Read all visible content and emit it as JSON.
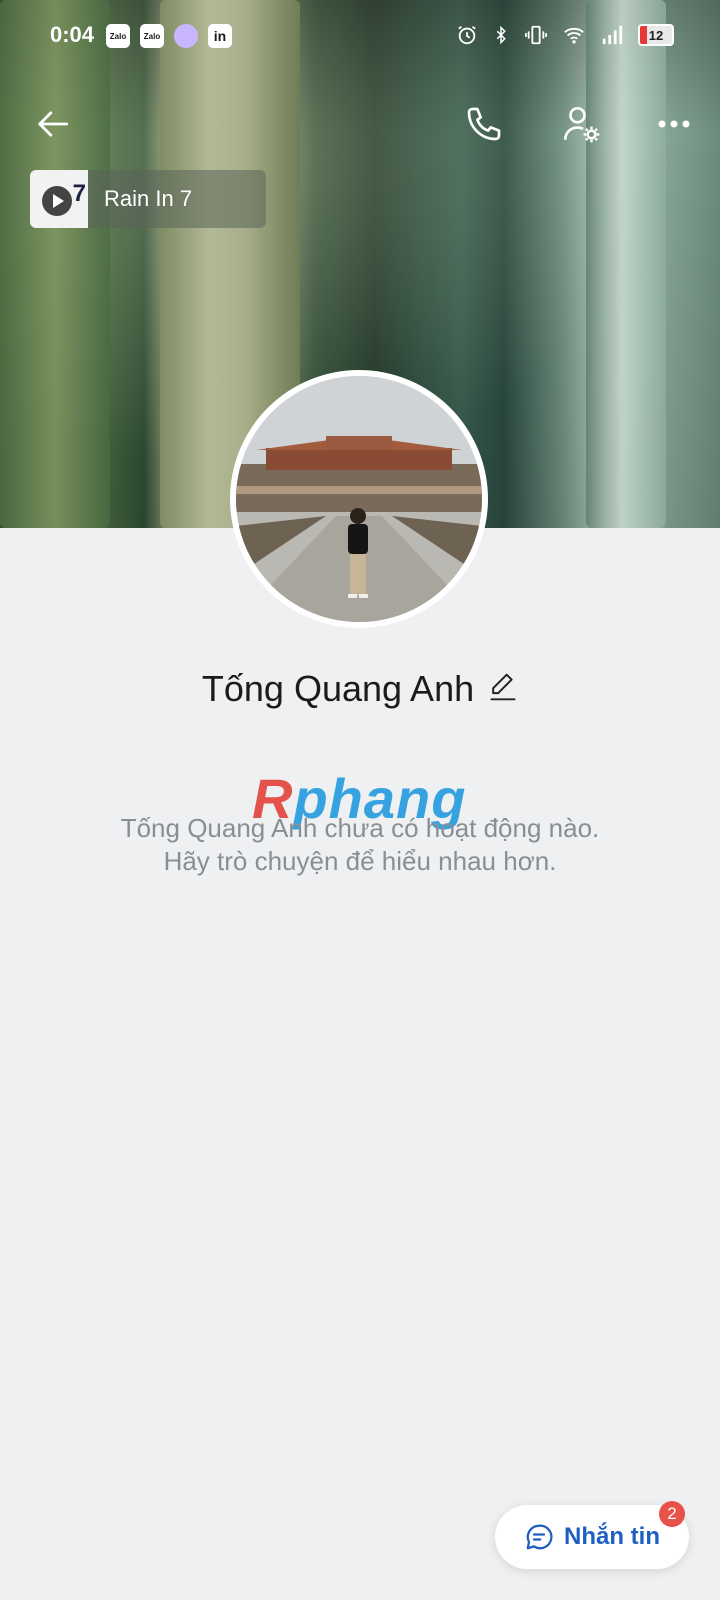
{
  "status_bar": {
    "time": "0:04",
    "app_icons": [
      "Zalo",
      "Zalo",
      "",
      "in"
    ],
    "battery": "12"
  },
  "music": {
    "title": "Rain In 7",
    "thumb_text": "7"
  },
  "profile": {
    "name": "Tống Quang Anh",
    "empty_line1": "Tống Quang Anh chưa có hoạt động nào.",
    "empty_line2": "Hãy trò chuyện để hiểu nhau hơn."
  },
  "watermark": {
    "part1": "R",
    "part2": "phang"
  },
  "chat_button": {
    "label": "Nhắn tin",
    "badge": "2"
  },
  "colors": {
    "accent": "#1f5fc4",
    "badge": "#e8524a",
    "background": "#eef0f2"
  }
}
